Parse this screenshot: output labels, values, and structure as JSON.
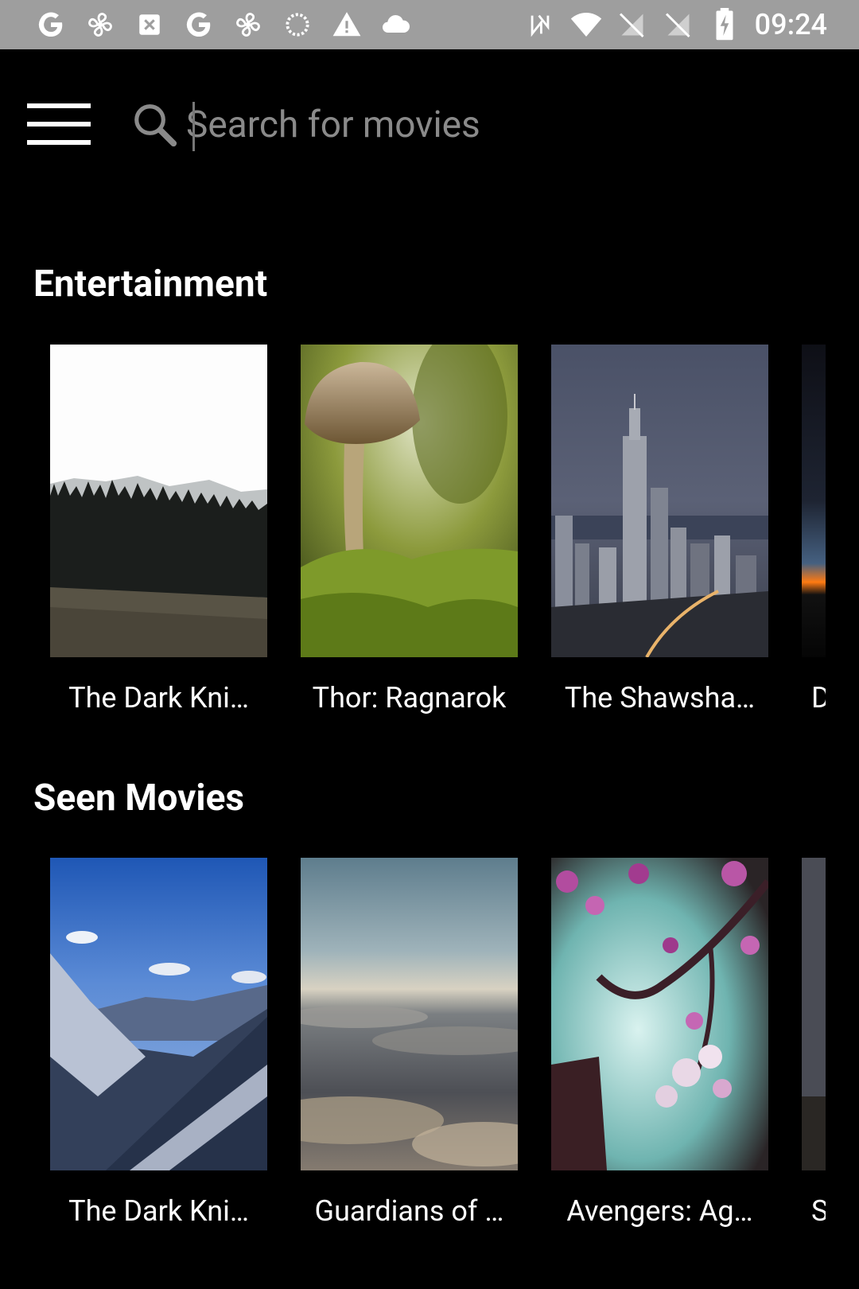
{
  "status_bar": {
    "time": "09:24",
    "left_icons": [
      "google-icon",
      "fan-icon",
      "image-icon",
      "google-icon",
      "fan-icon",
      "sync-icon",
      "warning-icon",
      "cloud-icon"
    ],
    "right_icons": [
      "nfc-icon",
      "wifi-icon",
      "no-sim-icon",
      "no-sim-icon",
      "battery-charging-icon"
    ]
  },
  "search": {
    "placeholder": "Search for movies",
    "value": ""
  },
  "sections": [
    {
      "title": "Entertainment",
      "items": [
        {
          "title": "The Dark Kni…",
          "image": "forest-field"
        },
        {
          "title": "Thor: Ragnarok",
          "image": "mushroom"
        },
        {
          "title": "The Shawsha…",
          "image": "city-skyline"
        },
        {
          "title": "D",
          "image": "sunset-dark"
        }
      ]
    },
    {
      "title": "Seen Movies",
      "items": [
        {
          "title": "The Dark Kni…",
          "image": "snowy-mountains"
        },
        {
          "title": "Guardians of …",
          "image": "clouds"
        },
        {
          "title": "Avengers: Ag…",
          "image": "cherry-blossom"
        },
        {
          "title": "S",
          "image": "dark-grey"
        }
      ]
    }
  ],
  "colors": {
    "background": "#000000",
    "status_bar": "#9e9e9e",
    "placeholder": "#8a8a8a"
  }
}
